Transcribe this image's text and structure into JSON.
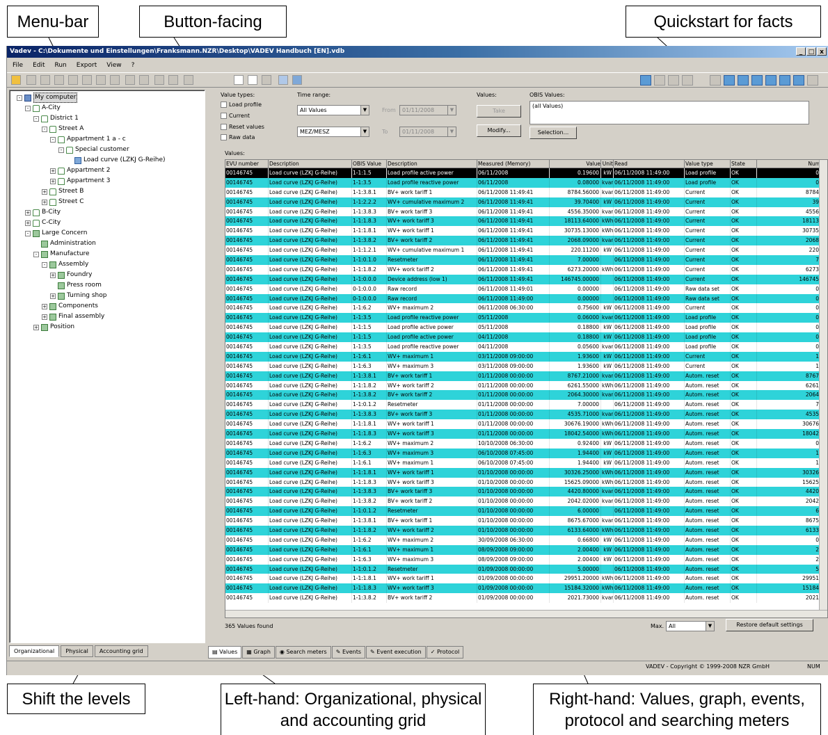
{
  "callouts": {
    "menubar": "Menu-bar",
    "button_facing": "Button-facing",
    "quickstart": "Quickstart for facts",
    "shift_levels": "Shift the levels",
    "left_hand": "Left-hand: Organizational, physical and accounting grid",
    "right_hand": "Right-hand: Values, graph, events, protocol and searching meters"
  },
  "window": {
    "title": "Vadev - C:\\Dokumente und Einstellungen\\Franksmann.NZR\\Desktop\\VADEV Handbuch [EN].vdb",
    "btn_min": "_",
    "btn_max": "□",
    "btn_close": "x"
  },
  "menu": [
    "File",
    "Edit",
    "Run",
    "Export",
    "View",
    "?"
  ],
  "tree": [
    {
      "label": "My computer",
      "level": 0,
      "exp": "-",
      "icon": "pc",
      "sel": true
    },
    {
      "label": "A-City",
      "level": 1,
      "exp": "-",
      "icon": "city"
    },
    {
      "label": "District 1",
      "level": 2,
      "exp": "-",
      "icon": "city"
    },
    {
      "label": "Street A",
      "level": 3,
      "exp": "-",
      "icon": "city"
    },
    {
      "label": "Appartment 1 a - c",
      "level": 4,
      "exp": "-",
      "icon": "city"
    },
    {
      "label": "Special customer",
      "level": 5,
      "exp": "-",
      "icon": "city"
    },
    {
      "label": "Load curve (LZKJ G-Reihe)",
      "level": 6,
      "exp": "",
      "icon": "meter"
    },
    {
      "label": "Appartment 2",
      "level": 4,
      "exp": "+",
      "icon": "city"
    },
    {
      "label": "Appartment 3",
      "level": 4,
      "exp": "+",
      "icon": "city"
    },
    {
      "label": "Street B",
      "level": 3,
      "exp": "+",
      "icon": "city"
    },
    {
      "label": "Street C",
      "level": 3,
      "exp": "+",
      "icon": "city"
    },
    {
      "label": "B-City",
      "level": 1,
      "exp": "+",
      "icon": "city"
    },
    {
      "label": "C-City",
      "level": 1,
      "exp": "+",
      "icon": "city"
    },
    {
      "label": "Large Concern",
      "level": 1,
      "exp": "-",
      "icon": "org"
    },
    {
      "label": "Administration",
      "level": 2,
      "exp": "",
      "icon": "org"
    },
    {
      "label": "Manufacture",
      "level": 2,
      "exp": "-",
      "icon": "org"
    },
    {
      "label": "Assembly",
      "level": 3,
      "exp": "-",
      "icon": "org"
    },
    {
      "label": "Foundry",
      "level": 4,
      "exp": "+",
      "icon": "org"
    },
    {
      "label": "Press room",
      "level": 4,
      "exp": "",
      "icon": "org"
    },
    {
      "label": "Turning shop",
      "level": 4,
      "exp": "+",
      "icon": "org"
    },
    {
      "label": "Components",
      "level": 3,
      "exp": "+",
      "icon": "org"
    },
    {
      "label": "Final assembly",
      "level": 3,
      "exp": "+",
      "icon": "org"
    },
    {
      "label": "Position",
      "level": 2,
      "exp": "+",
      "icon": "org"
    }
  ],
  "left_tabs": [
    "Organizational",
    "Physical",
    "Accounting grid"
  ],
  "filters": {
    "value_types_label": "Value types:",
    "checks": [
      "Load profile",
      "Current",
      "Reset values",
      "Raw data"
    ],
    "time_range_label": "Time range:",
    "time_range_value": "All Values",
    "timezone_value": "MEZ/MESZ",
    "from_label": "From",
    "to_label": "To",
    "from_date": "01/11/2008",
    "to_date": "01/11/2008",
    "values_label": "Values:",
    "values_btn": "Take",
    "modify_btn": "Modify...",
    "obis_label": "OBIS Values:",
    "obis_value": "(all Values)",
    "selection_btn": "Selection..."
  },
  "grid_label": "Values:",
  "columns": [
    "EVU number",
    "Description",
    "OBIS Value",
    "Description",
    "Measured (Memory)",
    "Value",
    "Unit",
    "Read",
    "Value type",
    "State",
    "Num"
  ],
  "rows": [
    [
      "00146745",
      "Load curve (LZKJ G-Reihe)",
      "1-1:1.5",
      "Load profile active power",
      "06/11/2008",
      "0.19600",
      "kW",
      "06/11/2008 11:49:00",
      "Load profile",
      "OK",
      "0",
      "sel"
    ],
    [
      "00146745",
      "Load curve (LZKJ G-Reihe)",
      "1-1:3.5",
      "Load profile reactive power",
      "06/11/2008",
      "0.08000",
      "kvar",
      "06/11/2008 11:49:00",
      "Load profile",
      "OK",
      "0",
      "cyan"
    ],
    [
      "00146745",
      "Load curve (LZKJ G-Reihe)",
      "1-1:3.8.1",
      "BV+ work tariff 1",
      "06/11/2008 11:49:41",
      "8784.56000",
      "kvarh",
      "06/11/2008 11:49:00",
      "Current",
      "OK",
      "8784",
      ""
    ],
    [
      "00146745",
      "Load curve (LZKJ G-Reihe)",
      "1-1:2.2.2",
      "WV+ cumulative maximum 2",
      "06/11/2008 11:49:41",
      "39.70400",
      "kW",
      "06/11/2008 11:49:00",
      "Current",
      "OK",
      "39",
      "cyan"
    ],
    [
      "00146745",
      "Load curve (LZKJ G-Reihe)",
      "1-1:3.8.3",
      "BV+ work tariff 3",
      "06/11/2008 11:49:41",
      "4556.35000",
      "kvarh",
      "06/11/2008 11:49:00",
      "Current",
      "OK",
      "4556",
      ""
    ],
    [
      "00146745",
      "Load curve (LZKJ G-Reihe)",
      "1-1:1.8.3",
      "WV+ work tariff 3",
      "06/11/2008 11:49:41",
      "18113.64000",
      "kWh",
      "06/11/2008 11:49:00",
      "Current",
      "OK",
      "18113",
      "cyan"
    ],
    [
      "00146745",
      "Load curve (LZKJ G-Reihe)",
      "1-1:1.8.1",
      "WV+ work tariff 1",
      "06/11/2008 11:49:41",
      "30735.13000",
      "kWh",
      "06/11/2008 11:49:00",
      "Current",
      "OK",
      "30735",
      ""
    ],
    [
      "00146745",
      "Load curve (LZKJ G-Reihe)",
      "1-1:3.8.2",
      "BV+ work tariff 2",
      "06/11/2008 11:49:41",
      "2068.09000",
      "kvarh",
      "06/11/2008 11:49:00",
      "Current",
      "OK",
      "2068",
      "cyan"
    ],
    [
      "00146745",
      "Load curve (LZKJ G-Reihe)",
      "1-1:1.2.1",
      "WV+ cumulative maximum 1",
      "06/11/2008 11:49:41",
      "220.11200",
      "kW",
      "06/11/2008 11:49:00",
      "Current",
      "OK",
      "220",
      ""
    ],
    [
      "00146745",
      "Load curve (LZKJ G-Reihe)",
      "1-1:0.1.0",
      "Resetmeter",
      "06/11/2008 11:49:41",
      "7.00000",
      "",
      "06/11/2008 11:49:00",
      "Current",
      "OK",
      "7",
      "cyan"
    ],
    [
      "00146745",
      "Load curve (LZKJ G-Reihe)",
      "1-1:1.8.2",
      "WV+ work tariff 2",
      "06/11/2008 11:49:41",
      "6273.20000",
      "kWh",
      "06/11/2008 11:49:00",
      "Current",
      "OK",
      "6273",
      ""
    ],
    [
      "00146745",
      "Load curve (LZKJ G-Reihe)",
      "1-1:0.0.0",
      "Device address (low 1)",
      "06/11/2008 11:49:41",
      "146745.00000",
      "",
      "06/11/2008 11:49:00",
      "Current",
      "OK",
      "146745",
      "cyan"
    ],
    [
      "00146745",
      "Load curve (LZKJ G-Reihe)",
      "0-1:0.0.0",
      "Raw record",
      "06/11/2008 11:49:01",
      "0.00000",
      "",
      "06/11/2008 11:49:00",
      "Raw data set",
      "OK",
      "0",
      ""
    ],
    [
      "00146745",
      "Load curve (LZKJ G-Reihe)",
      "0-1:0.0.0",
      "Raw record",
      "06/11/2008 11:49:00",
      "0.00000",
      "",
      "06/11/2008 11:49:00",
      "Raw data set",
      "OK",
      "0",
      "cyan"
    ],
    [
      "00146745",
      "Load curve (LZKJ G-Reihe)",
      "1-1:6.2",
      "WV+ maximum 2",
      "06/11/2008 06:30:00",
      "0.75600",
      "kW",
      "06/11/2008 11:49:00",
      "Current",
      "OK",
      "0",
      ""
    ],
    [
      "00146745",
      "Load curve (LZKJ G-Reihe)",
      "1-1:3.5",
      "Load profile reactive power",
      "05/11/2008",
      "0.06000",
      "kvar",
      "06/11/2008 11:49:00",
      "Load profile",
      "OK",
      "0",
      "cyan"
    ],
    [
      "00146745",
      "Load curve (LZKJ G-Reihe)",
      "1-1:1.5",
      "Load profile active power",
      "05/11/2008",
      "0.18800",
      "kW",
      "06/11/2008 11:49:00",
      "Load profile",
      "OK",
      "0",
      ""
    ],
    [
      "00146745",
      "Load curve (LZKJ G-Reihe)",
      "1-1:1.5",
      "Load profile active power",
      "04/11/2008",
      "0.18800",
      "kW",
      "06/11/2008 11:49:00",
      "Load profile",
      "OK",
      "0",
      "cyan"
    ],
    [
      "00146745",
      "Load curve (LZKJ G-Reihe)",
      "1-1:3.5",
      "Load profile reactive power",
      "04/11/2008",
      "0.05600",
      "kvar",
      "06/11/2008 11:49:00",
      "Load profile",
      "OK",
      "0",
      ""
    ],
    [
      "00146745",
      "Load curve (LZKJ G-Reihe)",
      "1-1:6.1",
      "WV+ maximum 1",
      "03/11/2008 09:00:00",
      "1.93600",
      "kW",
      "06/11/2008 11:49:00",
      "Current",
      "OK",
      "1",
      "cyan"
    ],
    [
      "00146745",
      "Load curve (LZKJ G-Reihe)",
      "1-1:6.3",
      "WV+ maximum 3",
      "03/11/2008 09:00:00",
      "1.93600",
      "kW",
      "06/11/2008 11:49:00",
      "Current",
      "OK",
      "1",
      ""
    ],
    [
      "00146745",
      "Load curve (LZKJ G-Reihe)",
      "1-1:3.8.1",
      "BV+ work tariff 1",
      "01/11/2008 00:00:00",
      "8767.21000",
      "kvarh",
      "06/11/2008 11:49:00",
      "Autom. reset",
      "OK",
      "8767",
      "cyan"
    ],
    [
      "00146745",
      "Load curve (LZKJ G-Reihe)",
      "1-1:1.8.2",
      "WV+ work tariff 2",
      "01/11/2008 00:00:00",
      "6261.55000",
      "kWh",
      "06/11/2008 11:49:00",
      "Autom. reset",
      "OK",
      "6261",
      ""
    ],
    [
      "00146745",
      "Load curve (LZKJ G-Reihe)",
      "1-1:3.8.2",
      "BV+ work tariff 2",
      "01/11/2008 00:00:00",
      "2064.30000",
      "kvarh",
      "06/11/2008 11:49:00",
      "Autom. reset",
      "OK",
      "2064",
      "cyan"
    ],
    [
      "00146745",
      "Load curve (LZKJ G-Reihe)",
      "1-1:0.1.2",
      "Resetmeter",
      "01/11/2008 00:00:00",
      "7.00000",
      "",
      "06/11/2008 11:49:00",
      "Autom. reset",
      "OK",
      "7",
      ""
    ],
    [
      "00146745",
      "Load curve (LZKJ G-Reihe)",
      "1-1:3.8.3",
      "BV+ work tariff 3",
      "01/11/2008 00:00:00",
      "4535.71000",
      "kvarh",
      "06/11/2008 11:49:00",
      "Autom. reset",
      "OK",
      "4535",
      "cyan"
    ],
    [
      "00146745",
      "Load curve (LZKJ G-Reihe)",
      "1-1:1.8.1",
      "WV+ work tariff 1",
      "01/11/2008 00:00:00",
      "30676.19000",
      "kWh",
      "06/11/2008 11:49:00",
      "Autom. reset",
      "OK",
      "30676",
      ""
    ],
    [
      "00146745",
      "Load curve (LZKJ G-Reihe)",
      "1-1:1.8.3",
      "WV+ work tariff 3",
      "01/11/2008 00:00:00",
      "18042.54000",
      "kWh",
      "06/11/2008 11:49:00",
      "Autom. reset",
      "OK",
      "18042",
      "cyan"
    ],
    [
      "00146745",
      "Load curve (LZKJ G-Reihe)",
      "1-1:6.2",
      "WV+ maximum 2",
      "10/10/2008 06:30:00",
      "0.92400",
      "kW",
      "06/11/2008 11:49:00",
      "Autom. reset",
      "OK",
      "0",
      ""
    ],
    [
      "00146745",
      "Load curve (LZKJ G-Reihe)",
      "1-1:6.3",
      "WV+ maximum 3",
      "06/10/2008 07:45:00",
      "1.94400",
      "kW",
      "06/11/2008 11:49:00",
      "Autom. reset",
      "OK",
      "1",
      "cyan"
    ],
    [
      "00146745",
      "Load curve (LZKJ G-Reihe)",
      "1-1:6.1",
      "WV+ maximum 1",
      "06/10/2008 07:45:00",
      "1.94400",
      "kW",
      "06/11/2008 11:49:00",
      "Autom. reset",
      "OK",
      "1",
      ""
    ],
    [
      "00146745",
      "Load curve (LZKJ G-Reihe)",
      "1-1:1.8.1",
      "WV+ work tariff 1",
      "01/10/2008 00:00:00",
      "30326.25000",
      "kWh",
      "06/11/2008 11:49:00",
      "Autom. reset",
      "OK",
      "30326",
      "cyan"
    ],
    [
      "00146745",
      "Load curve (LZKJ G-Reihe)",
      "1-1:1.8.3",
      "WV+ work tariff 3",
      "01/10/2008 00:00:00",
      "15625.09000",
      "kWh",
      "06/11/2008 11:49:00",
      "Autom. reset",
      "OK",
      "15625",
      ""
    ],
    [
      "00146745",
      "Load curve (LZKJ G-Reihe)",
      "1-1:3.8.3",
      "BV+ work tariff 3",
      "01/10/2008 00:00:00",
      "4420.80000",
      "kvarh",
      "06/11/2008 11:49:00",
      "Autom. reset",
      "OK",
      "4420",
      "cyan"
    ],
    [
      "00146745",
      "Load curve (LZKJ G-Reihe)",
      "1-1:3.8.2",
      "BV+ work tariff 2",
      "01/10/2008 00:00:00",
      "2042.02000",
      "kvarh",
      "06/11/2008 11:49:00",
      "Autom. reset",
      "OK",
      "2042",
      ""
    ],
    [
      "00146745",
      "Load curve (LZKJ G-Reihe)",
      "1-1:0.1.2",
      "Resetmeter",
      "01/10/2008 00:00:00",
      "6.00000",
      "",
      "06/11/2008 11:49:00",
      "Autom. reset",
      "OK",
      "6",
      "cyan"
    ],
    [
      "00146745",
      "Load curve (LZKJ G-Reihe)",
      "1-1:3.8.1",
      "BV+ work tariff 1",
      "01/10/2008 00:00:00",
      "8675.67000",
      "kvarh",
      "06/11/2008 11:49:00",
      "Autom. reset",
      "OK",
      "8675",
      ""
    ],
    [
      "00146745",
      "Load curve (LZKJ G-Reihe)",
      "1-1:1.8.2",
      "WV+ work tariff 2",
      "01/10/2008 00:00:00",
      "6133.64000",
      "kWh",
      "06/11/2008 11:49:00",
      "Autom. reset",
      "OK",
      "6133",
      "cyan"
    ],
    [
      "00146745",
      "Load curve (LZKJ G-Reihe)",
      "1-1:6.2",
      "WV+ maximum 2",
      "30/09/2008 06:30:00",
      "0.66800",
      "kW",
      "06/11/2008 11:49:00",
      "Autom. reset",
      "OK",
      "0",
      ""
    ],
    [
      "00146745",
      "Load curve (LZKJ G-Reihe)",
      "1-1:6.1",
      "WV+ maximum 1",
      "08/09/2008 09:00:00",
      "2.00400",
      "kW",
      "06/11/2008 11:49:00",
      "Autom. reset",
      "OK",
      "2",
      "cyan"
    ],
    [
      "00146745",
      "Load curve (LZKJ G-Reihe)",
      "1-1:6.3",
      "WV+ maximum 3",
      "08/09/2008 09:00:00",
      "2.00400",
      "kW",
      "06/11/2008 11:49:00",
      "Autom. reset",
      "OK",
      "2",
      ""
    ],
    [
      "00146745",
      "Load curve (LZKJ G-Reihe)",
      "1-1:0.1.2",
      "Resetmeter",
      "01/09/2008 00:00:00",
      "5.00000",
      "",
      "06/11/2008 11:49:00",
      "Autom. reset",
      "OK",
      "5",
      "cyan"
    ],
    [
      "00146745",
      "Load curve (LZKJ G-Reihe)",
      "1-1:1.8.1",
      "WV+ work tariff 1",
      "01/09/2008 00:00:00",
      "29951.20000",
      "kWh",
      "06/11/2008 11:49:00",
      "Autom. reset",
      "OK",
      "29951",
      ""
    ],
    [
      "00146745",
      "Load curve (LZKJ G-Reihe)",
      "1-1:1.8.3",
      "WV+ work tariff 3",
      "01/09/2008 00:00:00",
      "15184.32000",
      "kWh",
      "06/11/2008 11:49:00",
      "Autom. reset",
      "OK",
      "15184",
      "cyan"
    ],
    [
      "00146745",
      "Load curve (LZKJ G-Reihe)",
      "1-1:3.8.2",
      "BV+ work tariff 2",
      "01/09/2008 00:00:00",
      "2021.73000",
      "kvarh",
      "06/11/2008 11:49:00",
      "Autom. reset",
      "OK",
      "2021",
      ""
    ]
  ],
  "found_text": "365 Values found",
  "max_label": "Max.",
  "max_value": "All",
  "restore_btn": "Restore default settings",
  "right_tabs": [
    "Values",
    "Graph",
    "Search meters",
    "Events",
    "Event execution",
    "Protocol"
  ],
  "status": {
    "copyright": "VADEV - Copyright © 1999-2008 NZR GmbH",
    "num": "NUM"
  }
}
